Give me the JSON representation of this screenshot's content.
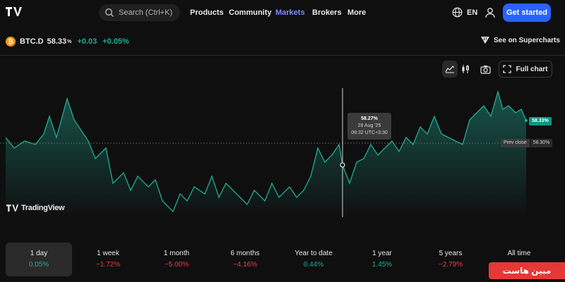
{
  "nav": {
    "search_placeholder": "Search (Ctrl+K)",
    "links": [
      "Products",
      "Community",
      "Markets",
      "Brokers",
      "More"
    ],
    "active_link": "Markets",
    "language": "EN",
    "cta": "Get started"
  },
  "symbol": {
    "name": "BTC.D",
    "price": "58.33",
    "unit": "%",
    "change_abs": "+0.03",
    "change_pct": "+0.05%",
    "supercharts": "See on Supercharts"
  },
  "toolbar": {
    "full_chart": "Full chart"
  },
  "chart": {
    "tooltip_value": "58.27%",
    "tooltip_date": "28 Aug '25",
    "tooltip_time": "08:32 UTC+3:30",
    "last_price_label": "58.33%",
    "prev_close_label": "Prev close",
    "prev_close_value": "58.30%",
    "watermark": "TradingView",
    "line_color": "#22ab94"
  },
  "ranges": [
    {
      "label": "1 day",
      "value": "0.05%",
      "dir": "pos"
    },
    {
      "label": "1 week",
      "value": "−1.72%",
      "dir": "neg"
    },
    {
      "label": "1 month",
      "value": "−5.00%",
      "dir": "neg"
    },
    {
      "label": "6 months",
      "value": "−4.16%",
      "dir": "neg"
    },
    {
      "label": "Year to date",
      "value": "0.44%",
      "dir": "pos"
    },
    {
      "label": "1 year",
      "value": "1.45%",
      "dir": "pos"
    },
    {
      "label": "5 years",
      "value": "−2.79%",
      "dir": "neg"
    },
    {
      "label": "All time",
      "value": "",
      "dir": "pos"
    }
  ],
  "active_range": "1 day",
  "badge": {
    "text": "مبین هاست"
  }
}
